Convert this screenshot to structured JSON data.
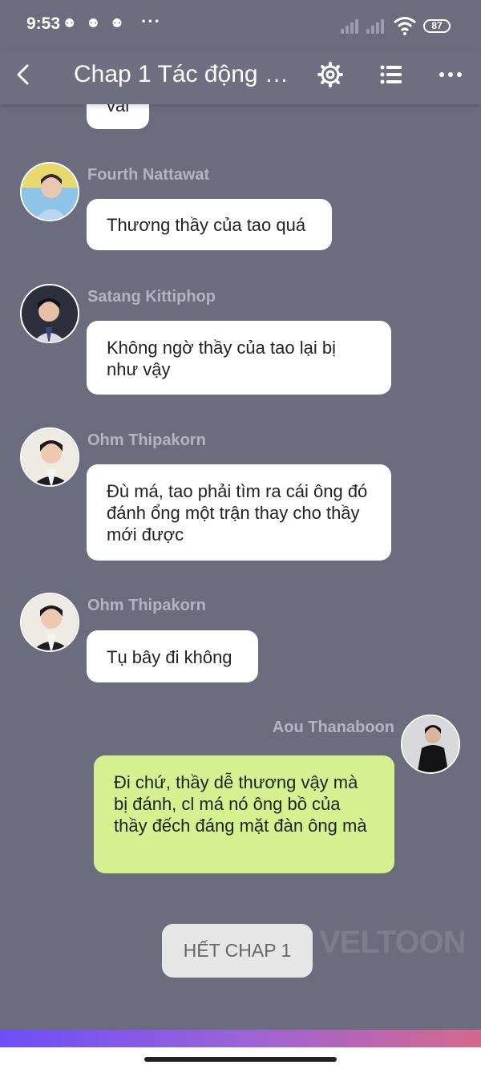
{
  "status_bar": {
    "time": "9:53",
    "notifications": "⚉ ⚉ ⚉",
    "more": "···",
    "battery": "87"
  },
  "nav": {
    "title": "Chap 1 Tác động v..."
  },
  "chat": {
    "partial_top_text": "vai",
    "messages": [
      {
        "sender": "Fourth Nattawat",
        "text": "Thương thầy của tao quá"
      },
      {
        "sender": "Satang Kittiphop",
        "text": "Không ngờ thầy của tao lại bị như vậy"
      },
      {
        "sender": "Ohm Thipakorn",
        "text": "Đù má, tao phải tìm ra cái ông đó đánh ổng một trận thay cho thầy mới được"
      },
      {
        "sender": "Ohm Thipakorn",
        "text": "Tụ bây đi không"
      },
      {
        "sender": "Aou Thanaboon",
        "text": "Đi chứ, thầy dễ thương vậy mà bị đánh, cl má nó ông bồ của thầy đếch đáng mặt đàn ông mà"
      }
    ],
    "end_button": "HẾT CHAP 1",
    "watermark": "VELTOON"
  },
  "colors": {
    "background": "#6b6c7d",
    "bubble_other": "#ffffff",
    "bubble_mine": "#d4f08f",
    "sender_name": "#b3b4c2"
  },
  "icons": {
    "back": "chevron-left-icon",
    "settings": "gear-icon",
    "list": "list-icon",
    "more": "more-dots-icon"
  }
}
